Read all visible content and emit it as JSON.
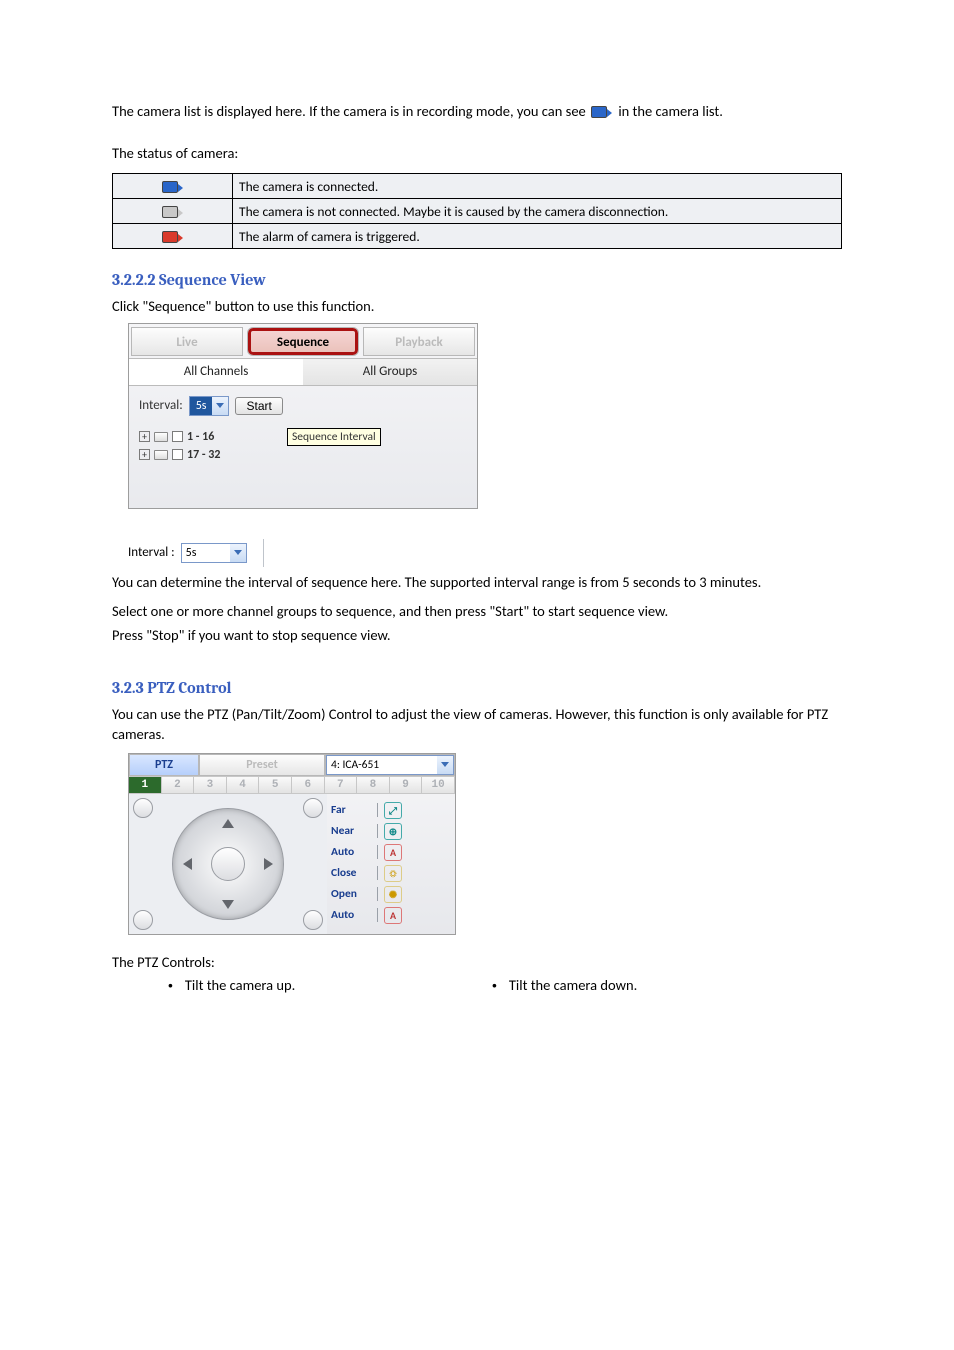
{
  "intro_para": "The camera list is displayed here. If the camera is in recording mode, you can see",
  "intro_after": "in the camera list.",
  "status_lead": "The status of camera:",
  "status_rows": [
    {
      "icon": "blue",
      "desc": "The camera is connected."
    },
    {
      "icon": "grey",
      "desc": "The camera is not connected. Maybe it is caused by the camera disconnection."
    },
    {
      "icon": "red",
      "desc": "The alarm of camera is triggered."
    }
  ],
  "sequence_heading": "3.2.2.2 Sequence View",
  "sequence_para": "Click \"Sequence\" button to use this function.",
  "seq_tabs": {
    "live": "Live",
    "sequence": "Sequence",
    "playback": "Playback"
  },
  "seq_subtabs": {
    "all_channels": "All Channels",
    "all_groups": "All Groups"
  },
  "seq_interval_label": "Interval:",
  "seq_interval_value": "5s",
  "seq_start": "Start",
  "seq_tooltip": "Sequence Interval",
  "seq_tree": [
    {
      "label": "1 - 16",
      "checked": true
    },
    {
      "label": "17 - 32",
      "checked": false
    }
  ],
  "interval_inline_label": "Interval :",
  "interval_inline_value": "5s",
  "interval_text_a": "You can determine the interval of sequence here. The supported interval range is from 5 seconds to 3 minutes.",
  "interval_text_b": "Select one or more channel groups to sequence, and then press \"Start\" to start sequence view.",
  "interval_text_c": "Press \"Stop\" if you want to stop sequence view.",
  "ptz_heading": "3.2.3 PTZ Control",
  "ptz_para": "You can use the PTZ (Pan/Tilt/Zoom) Control to adjust the view of cameras. However, this function is only available for PTZ cameras.",
  "ptz_tabs": {
    "ptz": "PTZ",
    "preset": "Preset",
    "device": "4: ICA-651"
  },
  "ptz_nums": [
    "1",
    "2",
    "3",
    "4",
    "5",
    "6",
    "7",
    "8",
    "9",
    "10"
  ],
  "ptz_rows": [
    {
      "label": "Far",
      "cls": "ric-teal",
      "glyph": "⤢"
    },
    {
      "label": "Near",
      "cls": "ric-teal",
      "glyph": "⊕"
    },
    {
      "label": "Auto",
      "cls": "ric-red",
      "glyph": "A"
    },
    {
      "label": "Close",
      "cls": "ric-yel",
      "glyph": "☼"
    },
    {
      "label": "Open",
      "cls": "ric-yel",
      "glyph": "✺"
    },
    {
      "label": "Auto",
      "cls": "ric-red",
      "glyph": "A"
    }
  ],
  "ptz_controls_label": "The PTZ Controls:",
  "ptz_buttons_line1": [
    {
      "icon": "",
      "desc": "Tilt the camera up."
    },
    {
      "icon": "",
      "desc": "Tilt the camera down."
    }
  ]
}
